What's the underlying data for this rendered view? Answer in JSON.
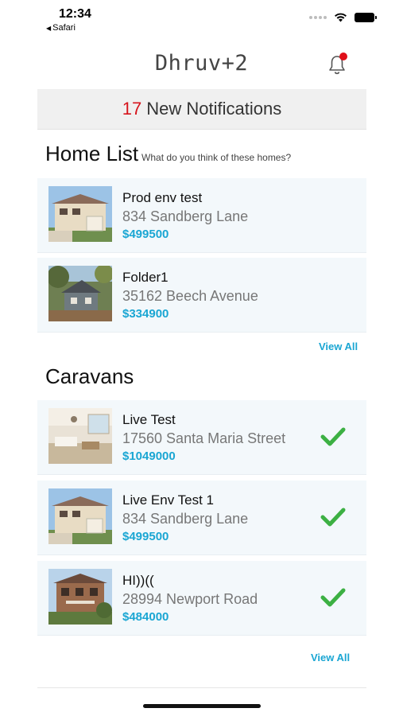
{
  "status_bar": {
    "time": "12:34",
    "back_label": "Safari",
    "back_icon": "left-triangle",
    "icons": [
      "signal-dots-icon",
      "wifi-icon",
      "battery-icon"
    ]
  },
  "header": {
    "title": "Dhruv+2",
    "bell_icon": "bell-icon",
    "badge_color": "#e0101a"
  },
  "notifications": {
    "count": "17",
    "label": "New Notifications",
    "count_color": "#d6141c"
  },
  "home_list": {
    "title": "Home List",
    "subtitle": "What do you think of these homes?",
    "items": [
      {
        "name": "Prod env test",
        "address": "834 Sandberg Lane",
        "price": "$499500",
        "photo": "house-photo-beige"
      },
      {
        "name": "Folder1",
        "address": "35162 Beech Avenue",
        "price": "$334900",
        "photo": "house-photo-cottage"
      }
    ],
    "view_all": "View All"
  },
  "caravans": {
    "title": "Caravans",
    "items": [
      {
        "name": "Live Test",
        "address": "17560 Santa Maria Street",
        "price": "$1049000",
        "photo": "interior-photo",
        "checked": true
      },
      {
        "name": "Live Env Test 1",
        "address": "834 Sandberg Lane",
        "price": "$499500",
        "photo": "house-photo-beige",
        "checked": true
      },
      {
        "name": "HI))((",
        "address": "28994 Newport Road",
        "price": "$484000",
        "photo": "house-photo-brown",
        "checked": true
      }
    ],
    "view_all": "View All"
  },
  "colors": {
    "accent": "#1aa6d3",
    "check": "#3cb043",
    "card_bg": "#f3f8fb"
  }
}
